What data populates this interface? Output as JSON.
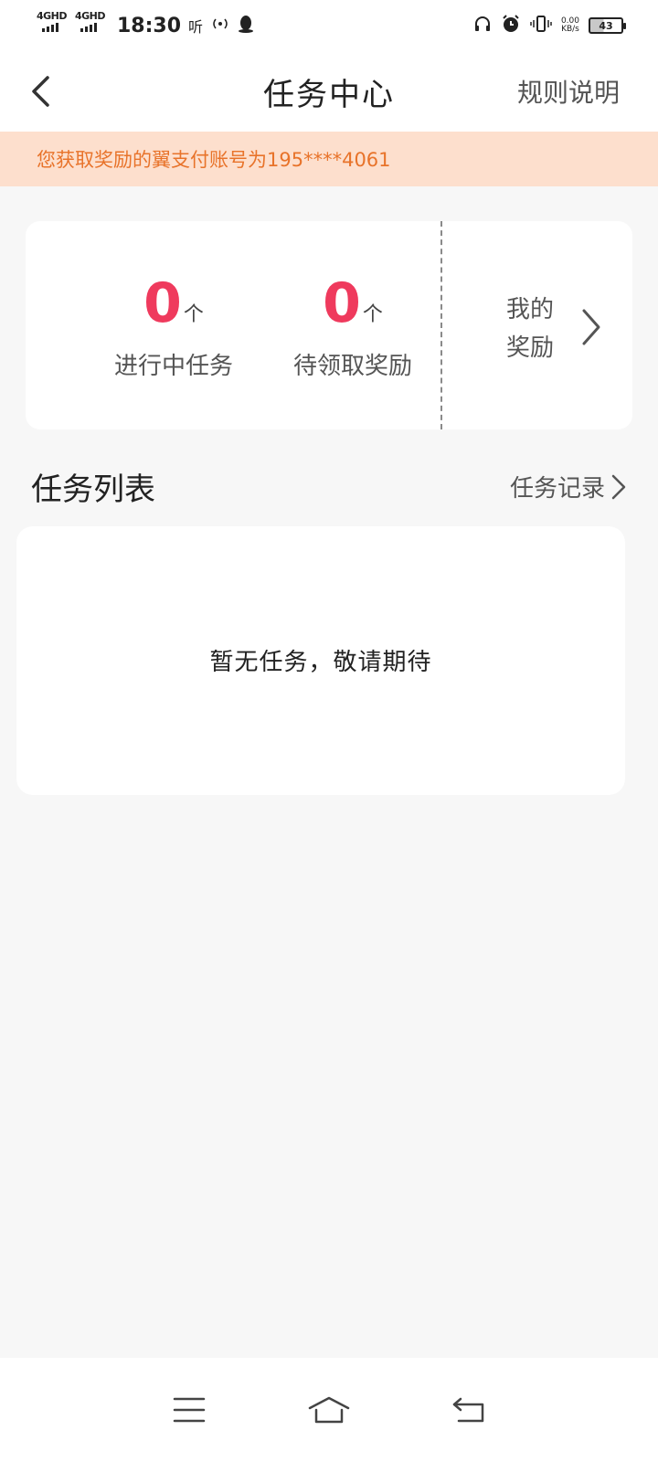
{
  "status_bar": {
    "network_1": "4GHD",
    "network_2": "4GHD",
    "time": "18:30",
    "ting_icon": "听",
    "speed_value": "0.00",
    "speed_unit": "KB/s",
    "battery": "43"
  },
  "header": {
    "title": "任务中心",
    "rules_label": "规则说明"
  },
  "notice": {
    "text": "您获取奖励的翼支付账号为195****4061"
  },
  "stats": {
    "in_progress": {
      "value": "0",
      "unit": "个",
      "label": "进行中任务"
    },
    "pending": {
      "value": "0",
      "unit": "个",
      "label": "待领取奖励"
    },
    "my_rewards_label": "我的奖励"
  },
  "task_list": {
    "title": "任务列表",
    "records_label": "任务记录",
    "empty_text": "暂无任务，敬请期待"
  },
  "colors": {
    "accent_red": "#ef3a5d",
    "notice_bg": "#fddfcd",
    "notice_text": "#e8732a"
  }
}
